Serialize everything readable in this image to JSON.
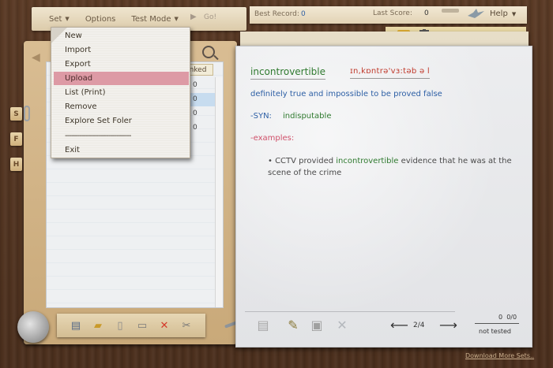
{
  "menu": {
    "items": [
      {
        "label": "Set"
      },
      {
        "label": "Options"
      },
      {
        "label": "Test Mode"
      }
    ],
    "go_label": "Go!"
  },
  "scores": {
    "best_label": "Best Record:",
    "best_value": "0",
    "last_label": "Last Score:",
    "last_value": "0"
  },
  "help_label": "Help",
  "set_list": {
    "ranked_header": "Ranked",
    "rank_values": [
      "0",
      "0",
      "0",
      "0"
    ]
  },
  "side_tabs": [
    "S",
    "F",
    "H"
  ],
  "dropdown": {
    "items": [
      "New",
      "Import",
      "Export",
      "Upload",
      "List (Print)",
      "Remove",
      "Explore Set Foler"
    ],
    "active": "Upload",
    "separator": "--------------------------------",
    "exit": "Exit"
  },
  "card": {
    "word": "incontrovertible",
    "phonetic": "ɪn,kɒntrə'vɜ:təb ə l",
    "definition": "definitely true and impossible to be proved false",
    "syn_label": "-SYN:",
    "syn_value": "indisputable",
    "examples_label": "-examples:",
    "example_before": "• CCTV provided ",
    "example_highlight": "incontrovertible",
    "example_after": " evidence that he was at the scene of the crime"
  },
  "pager": {
    "page": "2/4",
    "score_a": "0",
    "score_b": "0/0",
    "status": "not tested"
  },
  "download_link": "Download More Sets..",
  "colors": {
    "word": "#2f7a2f",
    "phonetic": "#c0392b",
    "definition": "#2d5fa5",
    "examples_label": "#d0506a",
    "menu_highlight": "#dd9aa5"
  }
}
